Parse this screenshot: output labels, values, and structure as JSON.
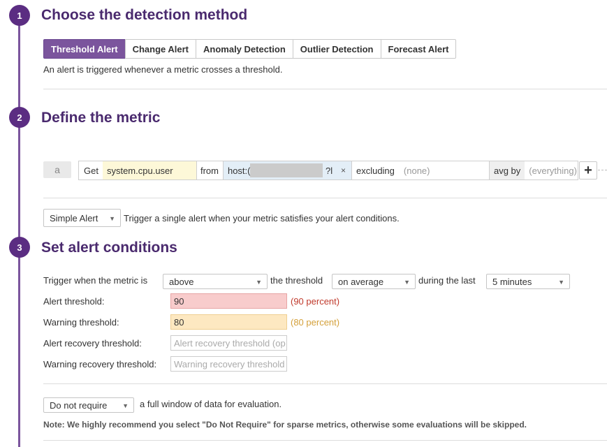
{
  "steps": {
    "one": {
      "number": "1",
      "title": "Choose the detection method"
    },
    "two": {
      "number": "2",
      "title": "Define the metric"
    },
    "three": {
      "number": "3",
      "title": "Set alert conditions"
    }
  },
  "detection_tabs": [
    {
      "label": "Threshold Alert",
      "active": true
    },
    {
      "label": "Change Alert",
      "active": false
    },
    {
      "label": "Anomaly Detection",
      "active": false
    },
    {
      "label": "Outlier Detection",
      "active": false
    },
    {
      "label": "Forecast Alert",
      "active": false
    }
  ],
  "detection_description": "An alert is triggered whenever a metric crosses a threshold.",
  "query": {
    "letter": "a",
    "get_label": "Get",
    "metric": "system.cpu.user",
    "from_label": "from",
    "host_prefix": "host:(",
    "host_suffix": "?l",
    "remove_icon": "×",
    "excluding_label": "excluding",
    "excluding_value": "(none)",
    "avg_by_label": "avg by",
    "avg_by_value": "(everything)",
    "add_icon": "+"
  },
  "alert_type": {
    "selected": "Simple Alert",
    "description": "Trigger a single alert when your metric satisfies your alert conditions."
  },
  "conditions": {
    "trigger_prefix": "Trigger when the metric is",
    "comparator": "above",
    "threshold_label": "the threshold",
    "aggregation": "on average",
    "during_label": "during the last",
    "window": "5 minutes",
    "alert_threshold_label": "Alert threshold:",
    "alert_threshold_value": "90",
    "alert_threshold_pct": "(90 percent)",
    "warning_threshold_label": "Warning threshold:",
    "warning_threshold_value": "80",
    "warning_threshold_pct": "(80 percent)",
    "alert_recovery_label": "Alert recovery threshold:",
    "alert_recovery_placeholder": "Alert recovery threshold (op",
    "warning_recovery_label": "Warning recovery threshold:",
    "warning_recovery_placeholder": "Warning recovery threshold"
  },
  "data_window": {
    "selected": "Do not require",
    "description": "a full window of data for evaluation.",
    "note": "Note: We highly recommend you select \"Do Not Require\" for sparse metrics, otherwise some evaluations will be skipped."
  },
  "colors": {
    "accent": "#7b559d",
    "badge": "#5b2d82",
    "alert": "#c0392b",
    "warning": "#d4a03a"
  }
}
